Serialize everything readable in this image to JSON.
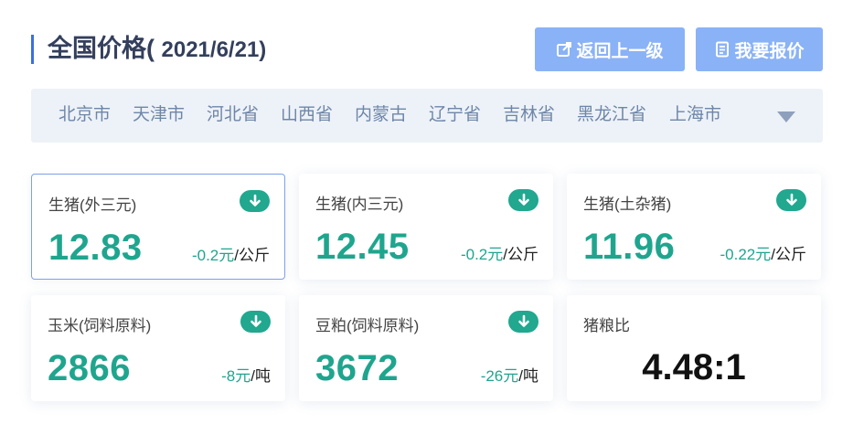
{
  "header": {
    "title": "全国价格(",
    "date": "2021/6/21)",
    "back_button_label": "返回上一级",
    "quote_button_label": "我要报价"
  },
  "provinces": [
    "北京市",
    "天津市",
    "河北省",
    "山西省",
    "内蒙古",
    "辽宁省",
    "吉林省",
    "黑龙江省",
    "上海市"
  ],
  "cards": [
    {
      "name": "生猪(外三元)",
      "value": "12.83",
      "delta": "-0.2元",
      "unit": "/公斤",
      "trend": "down"
    },
    {
      "name": "生猪(内三元)",
      "value": "12.45",
      "delta": "-0.2元",
      "unit": "/公斤",
      "trend": "down"
    },
    {
      "name": "生猪(土杂猪)",
      "value": "11.96",
      "delta": "-0.22元",
      "unit": "/公斤",
      "trend": "down"
    },
    {
      "name": "玉米(饲料原料)",
      "value": "2866",
      "delta": "-8元",
      "unit": "/吨",
      "trend": "down"
    },
    {
      "name": "豆粕(饲料原料)",
      "value": "3672",
      "delta": "-26元",
      "unit": "/吨",
      "trend": "down"
    },
    {
      "name": "猪粮比",
      "value": "4.48:1"
    }
  ],
  "colors": {
    "accent": "#21a88f",
    "button": "#8ab2f6",
    "title_bar": "#3b6fe0",
    "province_text": "#6e86a8"
  }
}
